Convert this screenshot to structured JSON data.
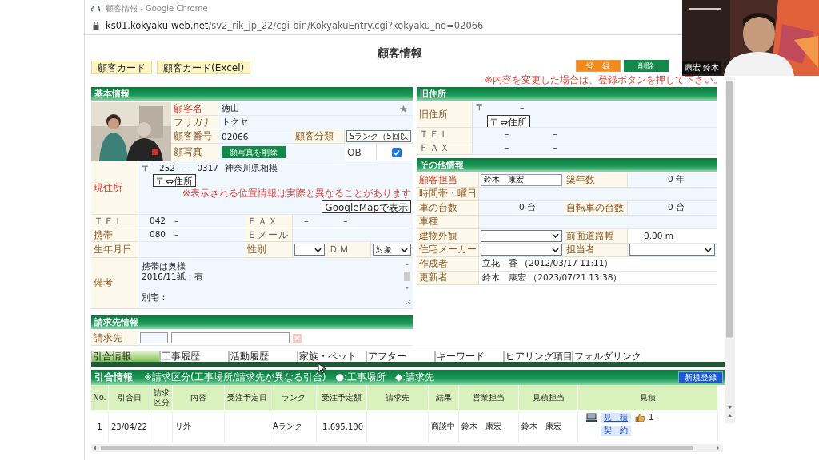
{
  "browser": {
    "title": "顧客情報 - Google Chrome",
    "url_host": "ks01.kokyaku-web.net",
    "url_path": "/sv2_rik_jp_22/cgi-bin/KokyakuEntry.cgi?kokyaku_no=02066"
  },
  "page_title": "顧客情報",
  "card_buttons": [
    "顧客カード",
    "顧客カード(Excel)"
  ],
  "register_button": "登　録",
  "delete_button": "削除",
  "notice": "※内容を変更した場合は、登録ボタンを押して下さい。",
  "basic": {
    "title": "基本情報",
    "name_label": {
      "text": "顧客名",
      "required": true
    },
    "name": "徳山",
    "kana_label": {
      "text": "フリガナ",
      "required": false
    },
    "kana": "トクヤ",
    "number_label": {
      "text": "顧客番号",
      "required": false
    },
    "number": "02066",
    "class_label": {
      "text": "顧客分類",
      "required": false
    },
    "class_value": "Sランク（5回以",
    "photo_label": {
      "text": "顔写真",
      "required": false
    },
    "photo_delete_button": "顔写真を削除",
    "ob_label": "OB",
    "ob_checked": true,
    "address_label": {
      "text": "現住所",
      "required": true
    },
    "postal": "〒　252　–　0317",
    "address": "神奈川県相模",
    "postal_button": "〒⇔住所",
    "map_notice": "※表示される位置情報は実際と異なることがあります",
    "map_button": "GoogleMapで表示",
    "tel_label": {
      "text": "ＴＥＬ",
      "required": false
    },
    "tel": "042　–",
    "fax_label": {
      "text": "ＦＡＸ",
      "required": false
    },
    "fax": "–　　　　–",
    "mobile_label": {
      "text": "携帯",
      "required": false
    },
    "mobile": "080　–",
    "email_label": {
      "text": "Ｅメール",
      "required": false
    },
    "birth_label": {
      "text": "生年月日",
      "required": false
    },
    "gender_label": {
      "text": "性別",
      "required": false
    },
    "dm_label": {
      "text": "ＤＭ",
      "required": false
    },
    "dm_value": "対象",
    "notes_label": {
      "text": "備考",
      "required": false
    },
    "notes": [
      "携帯は奥様",
      "2016/11紙：有",
      "別宅："
    ]
  },
  "billing": {
    "title": "請求先情報",
    "label": {
      "text": "請求先",
      "required": false
    }
  },
  "old_address": {
    "title": "旧住所",
    "address_label": {
      "text": "旧住所",
      "required": false
    },
    "postal": "〒　　　　–",
    "postal_button": "〒⇔住所",
    "tel_label": {
      "text": "ＴＥＬ",
      "required": false
    },
    "tel": "–　　　　　–",
    "fax_label": {
      "text": "ＦＡＸ",
      "required": false
    },
    "fax": "–　　　　　–"
  },
  "other": {
    "title": "その他情報",
    "staff_label": {
      "text": "顧客担当",
      "required": true
    },
    "staff": "鈴木　康宏",
    "age_label": {
      "text": "築年数",
      "required": false
    },
    "age": "0 年",
    "time_label": {
      "text": "時間帯・曜日",
      "required": false
    },
    "cars_label": {
      "text": "車の台数",
      "required": false
    },
    "cars": "0 台",
    "bikes_label": {
      "text": "自転車の台数",
      "required": false
    },
    "bikes": "0 台",
    "car_type_label": {
      "text": "車種",
      "required": false
    },
    "building_label": {
      "text": "建物外観",
      "required": false
    },
    "road_label": {
      "text": "前面道路幅",
      "required": false
    },
    "road": "0.00 m",
    "maker_label": {
      "text": "住宅メーカー",
      "required": false
    },
    "person_label": {
      "text": "担当者",
      "required": false
    },
    "created_label": {
      "text": "作成者",
      "required": false
    },
    "created": "立花　香 （2012/03/17 11:11）",
    "updated_label": {
      "text": "更新者",
      "required": false
    },
    "updated": "鈴木　康宏 （2023/07/21 13:38）"
  },
  "tabs": [
    {
      "label": "引合情報",
      "selected": true
    },
    {
      "label": "工事履歴",
      "selected": false
    },
    {
      "label": "活動履歴",
      "selected": false
    },
    {
      "label": "家族・ペット",
      "selected": false
    },
    {
      "label": "アフター",
      "selected": false
    },
    {
      "label": "キーワード",
      "selected": false
    },
    {
      "label": "ヒアリング項目",
      "selected": false
    },
    {
      "label": "フォルダリンク",
      "selected": false
    }
  ],
  "inquiry": {
    "title": "引合情報",
    "note": "※請求区分(工事場所/請求先が異なる引合)　●:工事場所　◆:請求先",
    "new_button": "新規登録",
    "columns": [
      "No.",
      "引合日",
      "請求区分",
      "内容",
      "受注予定日",
      "ランク",
      "受注予定額",
      "請求先",
      "結果",
      "営業担当",
      "見積担当",
      "見積"
    ],
    "rows": [
      {
        "no": "1",
        "date": "23/04/22",
        "content": "リ外",
        "rank": "Aランク",
        "amount": "1,695,100",
        "result": "商談中",
        "sales": "鈴木　康宏",
        "estimator": "鈴木　康宏",
        "links": [
          "見　積",
          "契　約"
        ],
        "likes": "1"
      }
    ]
  },
  "webcam": {
    "name": "康宏 鈴木"
  }
}
